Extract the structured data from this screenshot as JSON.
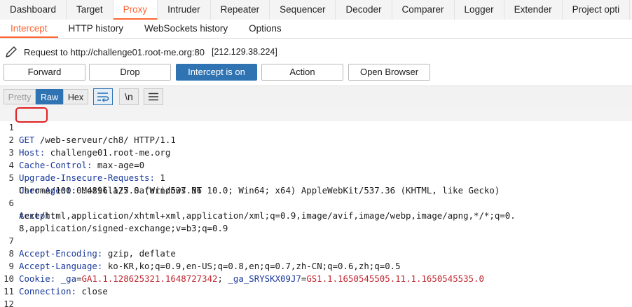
{
  "top_tabs": [
    "Dashboard",
    "Target",
    "Proxy",
    "Intruder",
    "Repeater",
    "Sequencer",
    "Decoder",
    "Comparer",
    "Logger",
    "Extender",
    "Project opti"
  ],
  "active_top_tab": "Proxy",
  "sub_tabs": [
    "Intercept",
    "HTTP history",
    "WebSockets history",
    "Options"
  ],
  "active_sub_tab": "Intercept",
  "request_info": {
    "label": "Request to http://challenge01.root-me.org:80",
    "ip": "[212.129.38.224]",
    "icon": "pencil-icon"
  },
  "buttons": {
    "forward": "Forward",
    "drop": "Drop",
    "intercept": "Intercept is on",
    "action": "Action",
    "open_browser": "Open Browser"
  },
  "format_buttons": {
    "pretty": "Pretty",
    "raw": "Raw",
    "hex": "Hex"
  },
  "tool_icons": [
    "wrap-lines-icon",
    "newline-icon",
    "menu-icon"
  ],
  "newline_label": "\\n",
  "colors": {
    "accent": "#ff6633",
    "primary": "#2f73b3",
    "header_name": "#1a3a9c",
    "cookie_value": "#c0262e"
  },
  "request_lines": {
    "l1_method": "GET",
    "l1_rest": " /web-serveur/ch8/ HTTP/1.1",
    "l2_name": "Host:",
    "l2_value": " challenge01.root-me.org",
    "l3_name": "Cache-Control:",
    "l3_value": " max-age=0",
    "l4_name": "Upgrade-Insecure-Requests:",
    "l4_value": " 1",
    "l5_name": "User-Agent:",
    "l5_value": " Mozilla/5.0 (Windows NT 10.0; Win64; x64) AppleWebKit/537.36 (KHTML, like Gecko)",
    "l5_cont": "Chrome/100.0.4896.127 Safari/537.36",
    "l6_name": "Accept:",
    "l6_cont1": "text/html,application/xhtml+xml,application/xml;q=0.9,image/avif,image/webp,image/apng,*/*;q=0.",
    "l6_cont2": "8,application/signed-exchange;v=b3;q=0.9",
    "l7_name": "Accept-Encoding:",
    "l7_value": " gzip, deflate",
    "l8_name": "Accept-Language:",
    "l8_value": " ko-KR,ko;q=0.9,en-US;q=0.8,en;q=0.7,zh-CN;q=0.6,zh;q=0.5",
    "l9_name": "Cookie:",
    "l9_k1": "_ga",
    "l9_v1": "GA1.1.128625321.1648727342",
    "l9_k2": "_ga_SRYSKX09J7",
    "l9_v2": "GS1.1.1650545505.11.1.1650545535.0",
    "l10_name": "Connection:",
    "l10_value": " close"
  },
  "line_numbers": [
    "1",
    "2",
    "3",
    "4",
    "5",
    "6",
    "7",
    "8",
    "9",
    "10",
    "11",
    "12"
  ]
}
